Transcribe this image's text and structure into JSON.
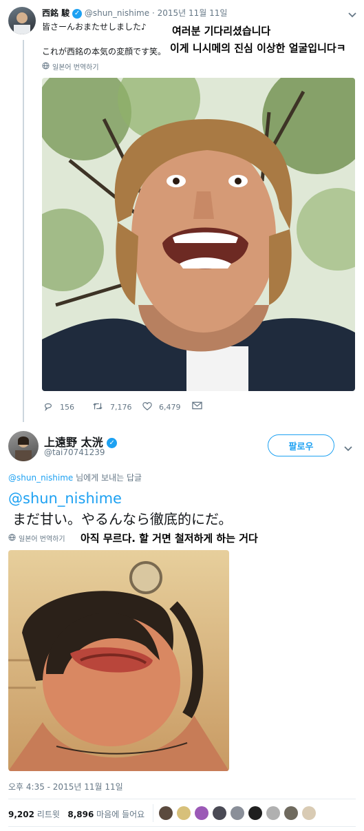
{
  "tweet1": {
    "name": "西銘 駿",
    "handle": "@shun_nishime",
    "separator": "·",
    "date": "2015년 11월 11일",
    "line1": "皆さーんおまたせしました♪",
    "line2": "これが西銘の本気の変顔です笑。",
    "translate_label": "일본어 번역하기",
    "replies": "156",
    "retweets": "7,176",
    "likes": "6,479"
  },
  "overlay_ko": {
    "line1": "여러분 기다리셨습니다",
    "line2": "이게 니시메의 진심 이상한 얼굴입니다ㅋ",
    "line3": "아직 무르다. 할 거면 철저하게 하는 거다"
  },
  "tweet2": {
    "name": "上遠野 太洸",
    "handle": "@tai70741239",
    "follow_label": "팔로우",
    "reply_to_handle": "@shun_nishime",
    "reply_to_suffix": " 님에게 보내는 답글",
    "mention": "@shun_nishime",
    "text": "まだ甘い。やるんなら徹底的にだ。",
    "translate_label": "일본어 번역하기",
    "timestamp": "오후 4:35 - 2015년 11월 11일",
    "retweet_count": "9,202",
    "retweet_label": "리트윗",
    "like_count": "8,896",
    "like_label": "마음에 들어요"
  },
  "icons": [
    "globe-icon",
    "reply-icon",
    "retweet-icon",
    "heart-icon",
    "envelope-icon",
    "verified-icon",
    "chevron-down-icon"
  ],
  "colors": {
    "accent": "#1da1f2",
    "muted": "#657786",
    "border": "#e6ecf0"
  }
}
